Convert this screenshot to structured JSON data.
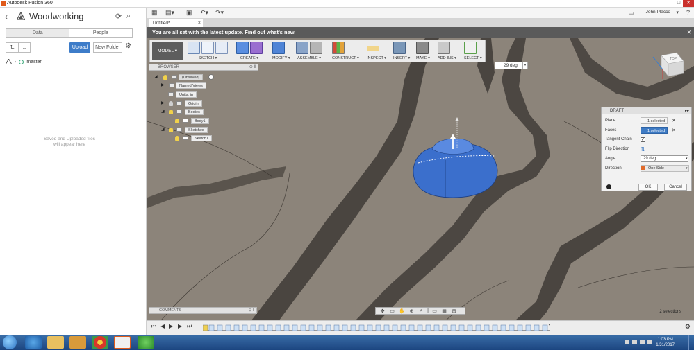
{
  "window": {
    "title": "Autodesk Fusion 360",
    "controls": [
      "minimize",
      "maximize",
      "close"
    ]
  },
  "data_panel": {
    "title": "Woodworking",
    "tabs": [
      {
        "label": "Data",
        "active": true
      },
      {
        "label": "People",
        "active": false
      }
    ],
    "upload_label": "Upload",
    "new_folder_label": "New Folder",
    "branch": "master",
    "empty_line1": "Saved and Uploaded files",
    "empty_line2": "will appear here"
  },
  "appbar": {
    "user": "John Placco"
  },
  "document_tab": {
    "label": "Untitled*"
  },
  "banner": {
    "text": "You are all set with the latest update.",
    "link": "Find out what's new."
  },
  "toolbar": {
    "mode": "MODEL",
    "groups": [
      {
        "label": "SKETCH",
        "icons": 3
      },
      {
        "label": "CREATE",
        "icons": 2
      },
      {
        "label": "MODIFY",
        "icons": 1
      },
      {
        "label": "ASSEMBLE",
        "icons": 2
      },
      {
        "label": "CONSTRUCT",
        "icons": 1
      },
      {
        "label": "INSPECT",
        "icons": 1
      },
      {
        "label": "INSERT",
        "icons": 1
      },
      {
        "label": "MAKE",
        "icons": 1
      },
      {
        "label": "ADD-INS",
        "icons": 1
      },
      {
        "label": "SELECT",
        "icons": 1
      }
    ]
  },
  "angle_input": {
    "value": "29 deg"
  },
  "browser": {
    "title": "BROWSER",
    "nodes": [
      {
        "label": "(Unsaved)"
      },
      {
        "label": "Named Views"
      },
      {
        "label": "Units: in"
      },
      {
        "label": "Origin"
      },
      {
        "label": "Bodies"
      },
      {
        "label": "Body1"
      },
      {
        "label": "Sketches"
      },
      {
        "label": "Sketch1"
      }
    ]
  },
  "draft_dialog": {
    "title": "DRAFT",
    "plane_label": "Plane",
    "plane_value": "1 selected",
    "faces_label": "Faces",
    "faces_value": "1 selected",
    "tangent_label": "Tangent Chain",
    "tangent_checked": "✓",
    "flip_label": "Flip Direction",
    "angle_label": "Angle",
    "angle_value": "29 deg",
    "direction_label": "Direction",
    "direction_value": "One Side",
    "ok_label": "OK",
    "cancel_label": "Cancel"
  },
  "comments": {
    "title": "COMMENTS"
  },
  "status": {
    "selections": "2 selections"
  },
  "viewcube": {
    "face": "TOP"
  },
  "taskbar": {
    "time": "1:03 PM",
    "date": "1/31/2017"
  },
  "colors": {
    "viewport": "#8c847a",
    "body": "#3b6fcc",
    "accent": "#3e7bc4",
    "banner": "#5a5a5a"
  }
}
